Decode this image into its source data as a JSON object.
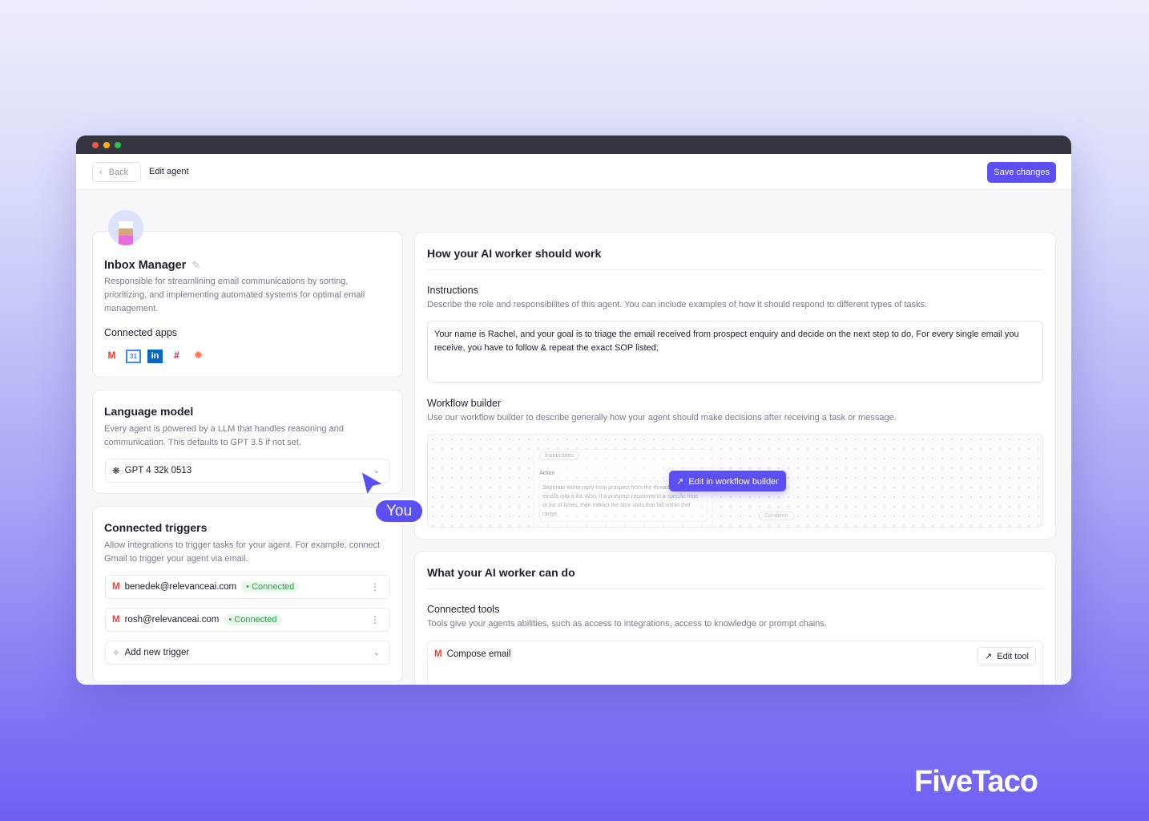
{
  "header": {
    "back_label": "Back",
    "title": "Edit agent",
    "save_label": "Save changes"
  },
  "agent": {
    "name": "Inbox Manager",
    "description": "Responsible for streamlining email communications by sorting, prioritizing, and implementing automated systems for optimal email management.",
    "connected_apps_label": "Connected apps",
    "apps": [
      "gmail",
      "google-calendar",
      "linkedin",
      "slack",
      "hubspot"
    ]
  },
  "language_model": {
    "title": "Language model",
    "description": "Every agent is powered by a LLM that handles reasoning and communication. This defaults to GPT 3.5 if not set.",
    "selected": "GPT 4 32k 0513"
  },
  "cursor": {
    "label": "You"
  },
  "triggers": {
    "title": "Connected triggers",
    "description": "Allow integrations to trigger tasks for your agent. For example, connect Gmail to trigger your agent via email.",
    "items": [
      {
        "email": "benedek@relevanceai.com",
        "status": "Connected"
      },
      {
        "email": "rosh@relevanceai.com",
        "status": "Connected"
      }
    ],
    "add_label": "Add new trigger"
  },
  "how": {
    "title": "How your AI worker should work",
    "instructions_label": "Instructions",
    "instructions_desc": "Describe the role and responsibilites of this agent. You can include examples of how it should respond to different types of tasks.",
    "instructions_value": "Your name is Rachel, and your goal is to triage the email received from prospect enquiry and decide on the next step to do, For every single email you receive, you have to follow & repeat the exact SOP listed;",
    "workflow_label": "Workflow builder",
    "workflow_desc": "Use our workflow builder to describe generally how your agent should make decisions after receiving a task or message.",
    "preview": {
      "node_label": "Instructions",
      "action_label": "Action",
      "action_text": "Seperate latest reply from prospect from the thread and put the emails into a list. Also, if a prospect recommend a specific time or list of times, then extract the time slots that fall within that range",
      "condition_label": "Condition"
    },
    "edit_workflow_label": "Edit in workflow builder"
  },
  "can_do": {
    "title": "What your AI worker can do",
    "tools_label": "Connected tools",
    "tools_desc": "Tools give your agents abilities, such as access to integrations, access to knowledge or prompt chains.",
    "tools": [
      {
        "name": "Compose email",
        "action": "Edit tool"
      }
    ]
  },
  "brand": "FiveTaco",
  "colors": {
    "accent": "#5b4ff5",
    "connected": "#27a345"
  }
}
